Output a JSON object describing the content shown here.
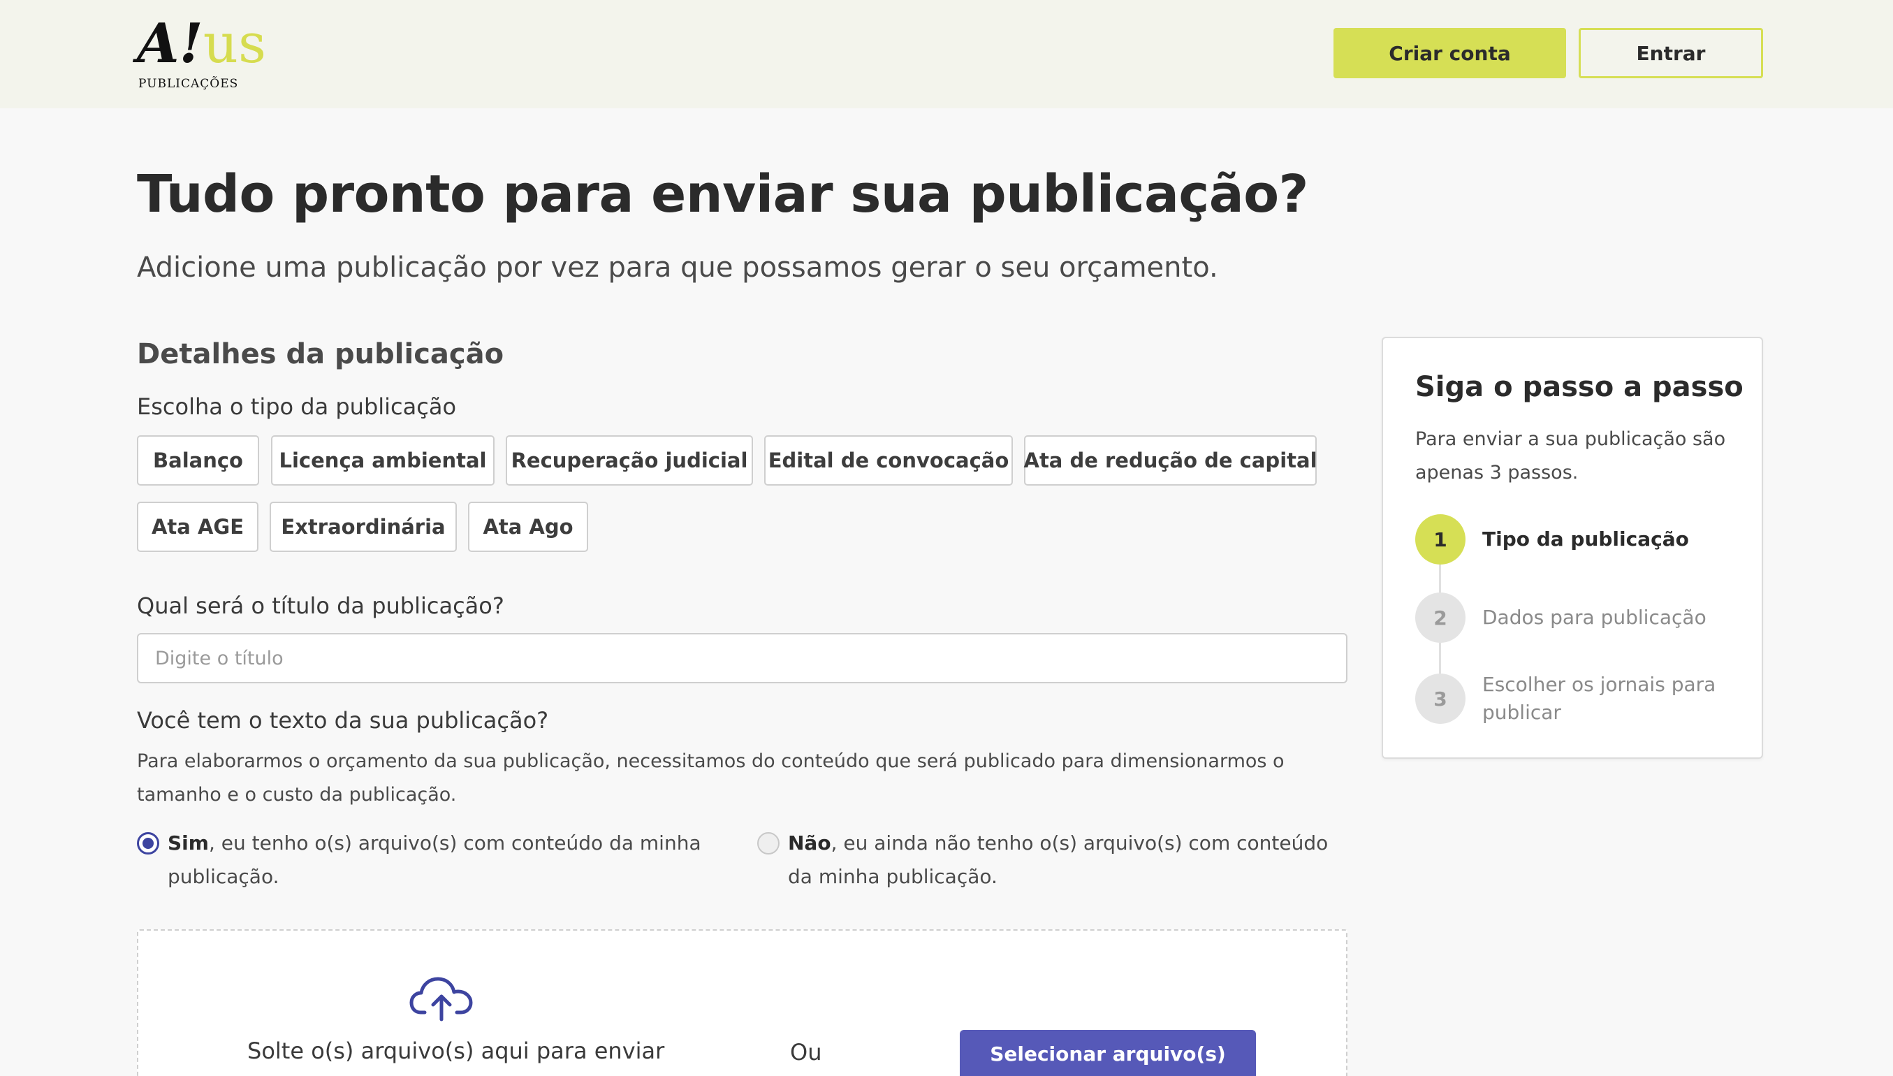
{
  "header": {
    "logo_text": "A!us",
    "logo_subtext": "PUBLICAÇÕES",
    "create_account_label": "Criar conta",
    "login_label": "Entrar"
  },
  "main": {
    "title": "Tudo pronto para enviar sua publicação?",
    "subtitle": "Adicione uma publicação por vez para que possamos gerar o seu orçamento.",
    "section_title": "Detalhes da publicação",
    "type_label": "Escolha o tipo da publicação",
    "types": [
      "Balanço",
      "Licença ambiental",
      "Recuperação judicial",
      "Edital de convocação",
      "Ata de redução de capital",
      "Ata AGE",
      "Extraordinária",
      "Ata Ago"
    ],
    "title_question": "Qual será o título da publicação?",
    "title_input": {
      "value": "",
      "placeholder": "Digite o título"
    },
    "text_question": "Você tem o texto da sua publicação?",
    "text_help": "Para elaborarmos o orçamento da sua publicação, necessitamos do conteúdo que será publicado para dimensionarmos o tamanho e o custo da publicação.",
    "options": [
      {
        "strong": "Sim",
        "text": ", eu tenho o(s) arquivo(s) com conteúdo da minha publicação.",
        "selected": true
      },
      {
        "strong": "Não",
        "text": ", eu ainda não tenho o(s) arquivo(s) com conteúdo da minha publicação.",
        "selected": false
      }
    ],
    "dropzone": {
      "icon": "cloud-upload-icon",
      "drop_text": "Solte o(s) arquivo(s) aqui para enviar",
      "or_text": "Ou",
      "select_label": "Selecionar arquivo(s)"
    }
  },
  "steps": {
    "title": "Siga o passo a passo",
    "description": "Para enviar a sua publicação são apenas 3 passos.",
    "items": [
      {
        "number": "1",
        "label": "Tipo da publicação",
        "active": true
      },
      {
        "number": "2",
        "label": "Dados para publicação",
        "active": false
      },
      {
        "number": "3",
        "label": "Escolher os jornais para publicar",
        "active": false
      }
    ]
  },
  "colors": {
    "accent": "#d6df55",
    "primary_button": "#5659b8",
    "radio": "#3d44a0",
    "header_bg": "#f3f4ec",
    "page_bg": "#f8f8f8"
  }
}
